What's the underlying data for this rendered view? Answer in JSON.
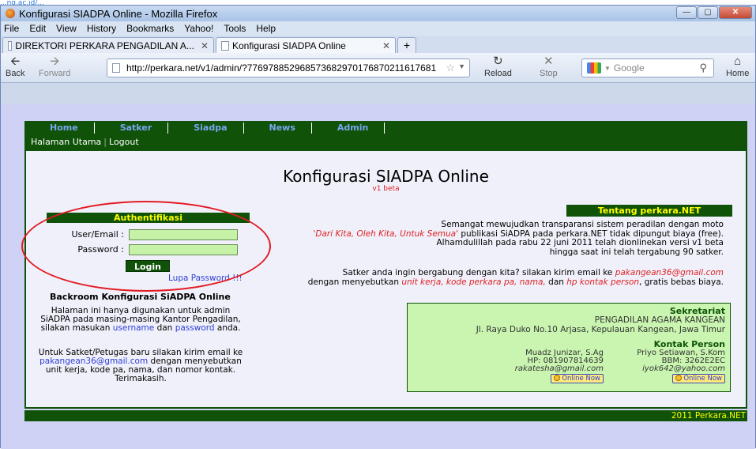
{
  "annotation": "...ng.ac.id/...",
  "browser": {
    "title": "Konfigurasi SIADPA Online - Mozilla Firefox",
    "menu": [
      "File",
      "Edit",
      "View",
      "History",
      "Bookmarks",
      "Yahoo!",
      "Tools",
      "Help"
    ],
    "tabs": [
      {
        "label": "DIREKTORI PERKARA PENGADILAN A...",
        "active": false
      },
      {
        "label": "Konfigurasi SIADPA Online",
        "active": true
      }
    ],
    "toolbar": {
      "back": "Back",
      "forward": "Forward",
      "reload": "Reload",
      "stop": "Stop",
      "home": "Home"
    },
    "url": "http://perkara.net/v1/admin/?776978852968573682970176870211617681",
    "search_placeholder": "Google"
  },
  "site": {
    "nav": [
      "Home",
      "Satker",
      "Siadpa",
      "News",
      "Admin"
    ],
    "subnav": {
      "home": "Halaman Utama",
      "sep": "|",
      "logout": "Logout"
    },
    "title": "Konfigurasi SIADPA Online",
    "version": "v1 beta",
    "about": {
      "heading": "Tentang perkara.NET",
      "line1": "Semangat mewujudkan transparansi sistem peradilan dengan moto",
      "line2_quote": "'Dari Kita, Oleh Kita, Untuk Semua'",
      "line2_rest": " publikasi SiADPA pada perkara.NET tidak dipungut biaya (free).",
      "line3": "Alhamdulillah pada rabu 22 juni 2011 telah dionlinekan versi v1 beta",
      "line4": "hingga saat ini telah tergabung 90 satker."
    },
    "join": {
      "a": "Satker anda ingin bergabung dengan kita? silakan kirim email ke ",
      "email": "pakangean36@gmail.com",
      "b": "dengan menyebutkan ",
      "fields": "unit kerja, kode perkara pa, nama,",
      "c": " dan ",
      "hp": "hp kontak person",
      "d": ", gratis bebas biaya."
    },
    "auth": {
      "heading": "Authentifikasi",
      "user_label": "User/Email :",
      "pass_label": "Password :",
      "login": "Login",
      "forgot": "Lupa Password !!!"
    },
    "backroom": {
      "title": "Backroom Konfigurasi SiADPA Online",
      "p1a": "Halaman ini hanya digunakan untuk admin SiADPA pada masing-masing Kantor Pengadilan, silakan masukan ",
      "p1_username": "username",
      "p1b": " dan ",
      "p1_password": "password",
      "p1c": " anda.",
      "p2a": "Untuk Satket/Petugas baru silakan kirim email ke ",
      "p2_email": "pakangean36@gmail.com",
      "p2b": " dengan menyebutkan unit kerja, kode pa, nama, dan nomor kontak. Terimakasih."
    },
    "secretariat": {
      "title": "Sekretariat",
      "name": "PENGADILAN AGAMA KANGEAN",
      "address": "Jl. Raya Duko No.10 Arjasa, Kepulauan Kangean, Jawa Timur",
      "contact_title": "Kontak Person",
      "persons": [
        {
          "name": "Muadz Junizar, S.Ag",
          "phone": "HP: 081907814639",
          "email": "rakatesha@gmail.com",
          "status": "Online Now"
        },
        {
          "name": "Priyo Setiawan, S.Kom",
          "phone": "BBM: 3262E2EC",
          "email": "iyok642@yahoo.com",
          "status": "Online Now"
        }
      ]
    },
    "footer": "2011 Perkara.NET"
  }
}
